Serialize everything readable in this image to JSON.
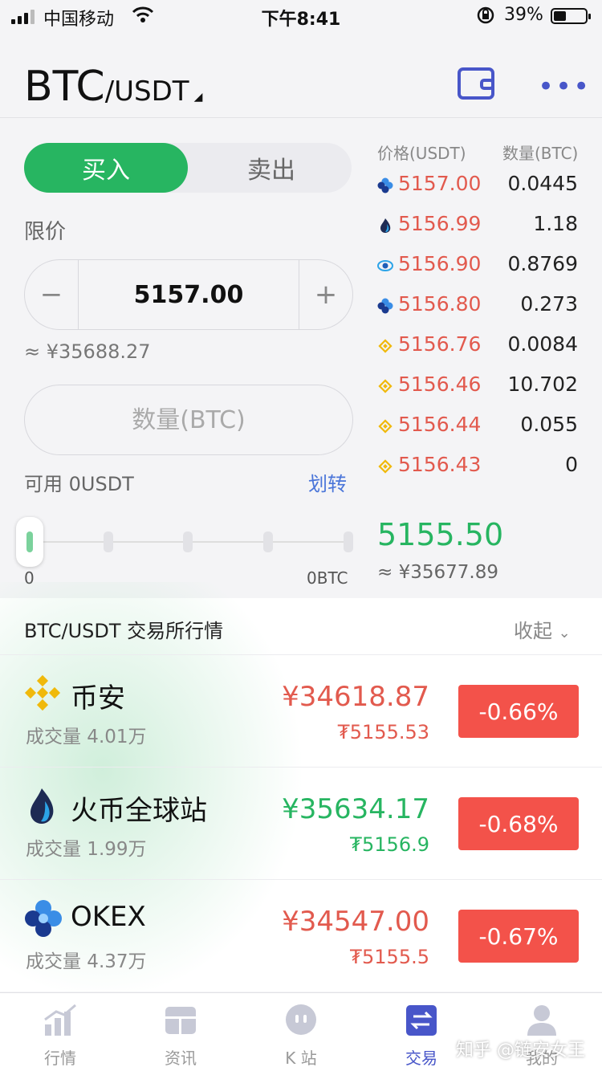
{
  "status_bar": {
    "carrier": "中国移动",
    "time": "下午8:41",
    "battery": "39%",
    "battery_level": 0.39
  },
  "header": {
    "base": "BTC",
    "quote": "/USDT"
  },
  "trade": {
    "buy_label": "买入",
    "sell_label": "卖出",
    "order_type": "限价",
    "price_value": "5157.00",
    "minus": "−",
    "plus": "+",
    "price_cny": "≈ ¥35688.27",
    "qty_placeholder": "数量(BTC)",
    "available": "可用 0USDT",
    "transfer": "划转",
    "slider_min": "0",
    "slider_max": "0BTC",
    "slider_value": 0
  },
  "order_book": {
    "price_header": "价格(USDT)",
    "qty_header": "数量(BTC)",
    "rows": [
      {
        "exchange_icon": "okex-icon",
        "price": "5157.00",
        "qty": "0.0445"
      },
      {
        "exchange_icon": "huobi-icon",
        "price": "5156.99",
        "qty": "1.18"
      },
      {
        "exchange_icon": "eye-exchange-icon",
        "price": "5156.90",
        "qty": "0.8769"
      },
      {
        "exchange_icon": "okex-icon",
        "price": "5156.80",
        "qty": "0.273"
      },
      {
        "exchange_icon": "binance-icon",
        "price": "5156.76",
        "qty": "0.0084"
      },
      {
        "exchange_icon": "binance-icon",
        "price": "5156.46",
        "qty": "10.702"
      },
      {
        "exchange_icon": "binance-icon",
        "price": "5156.44",
        "qty": "0.055"
      },
      {
        "exchange_icon": "binance-icon",
        "price": "5156.43",
        "qty": "0"
      }
    ],
    "last_price": "5155.50",
    "last_cny": "≈ ¥35677.89"
  },
  "market": {
    "title": "BTC/USDT 交易所行情",
    "collapse": "收起",
    "exchanges": [
      {
        "name": "币安",
        "volume": "成交量 4.01万",
        "cny": "¥34618.87",
        "usdt": "₮5155.53",
        "change": "-0.66%",
        "price_color": "red"
      },
      {
        "name": "火币全球站",
        "volume": "成交量 1.99万",
        "cny": "¥35634.17",
        "usdt": "₮5156.9",
        "change": "-0.68%",
        "price_color": "green"
      },
      {
        "name": "OKEX",
        "volume": "成交量 4.37万",
        "cny": "¥34547.00",
        "usdt": "₮5155.5",
        "change": "-0.67%",
        "price_color": "red"
      }
    ]
  },
  "tabbar": {
    "tabs": [
      {
        "label": "行情"
      },
      {
        "label": "资讯"
      },
      {
        "label": "K 站"
      },
      {
        "label": "交易"
      },
      {
        "label": "我的"
      }
    ],
    "active": 3
  },
  "watermark": "知乎 @链安女王",
  "colors": {
    "buy_green": "#27b561",
    "sell_red": "#e25a4e",
    "change_red": "#f3524a",
    "accent": "#4856c9"
  }
}
